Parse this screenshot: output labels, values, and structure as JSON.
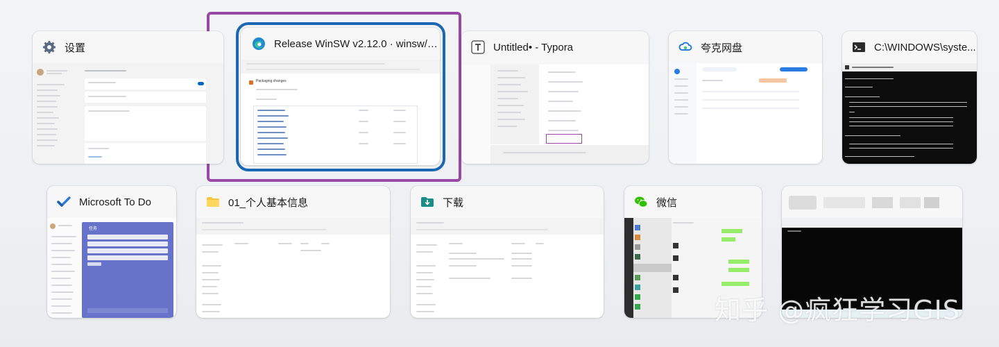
{
  "windows": [
    {
      "id": "settings",
      "title": "设置",
      "icon": "gear-icon"
    },
    {
      "id": "edge",
      "title": "Release WinSW v2.12.0 · winsw/w...",
      "icon": "edge-icon"
    },
    {
      "id": "typora",
      "title": "Untitled• - Typora",
      "icon": "typora-icon"
    },
    {
      "id": "quark",
      "title": "夸克网盘",
      "icon": "cloud-drive-icon"
    },
    {
      "id": "cmd",
      "title": "C:\\WINDOWS\\syste...",
      "icon": "terminal-icon"
    },
    {
      "id": "todo",
      "title": "Microsoft To Do",
      "icon": "todo-check-icon"
    },
    {
      "id": "folder1",
      "title": "01_个人基本信息",
      "icon": "folder-icon"
    },
    {
      "id": "downloads",
      "title": "下载",
      "icon": "download-folder-icon"
    },
    {
      "id": "wechat",
      "title": "微信",
      "icon": "wechat-icon"
    },
    {
      "id": "blurred",
      "title": "",
      "icon": ""
    }
  ],
  "thumbnails": {
    "edge_section": "Packaging changes",
    "todo_list_title": "任务"
  },
  "watermark": "知乎 @疯狂学习GIS",
  "colors": {
    "selection_outer": "#9a48a5",
    "selection_inner": "#1a67b4",
    "todo_accent": "#6673c9",
    "cmd_bg": "#0c0c0c",
    "wechat_sidebar": "#2e2e2e"
  }
}
